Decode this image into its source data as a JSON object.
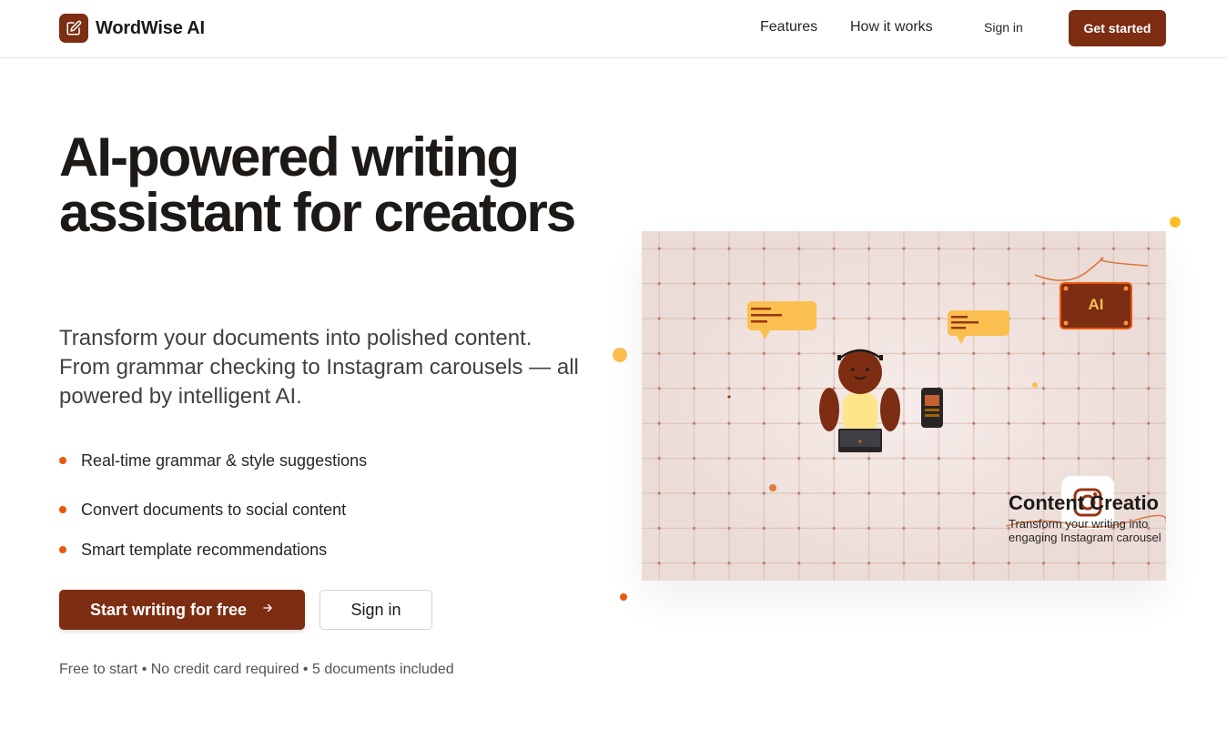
{
  "header": {
    "brand": "WordWise AI",
    "nav": {
      "features": "Features",
      "how_it_works": "How it works"
    },
    "sign_in": "Sign in",
    "get_started": "Get started"
  },
  "hero": {
    "title": "AI-powered writing assistant for creators",
    "subtitle": "Transform your documents into polished content. From grammar checking to Instagram carousels — all powered by intelligent AI.",
    "features": [
      "Real-time grammar & style suggestions",
      "Convert documents to social content",
      "Smart template recommendations"
    ],
    "cta_primary": "Start writing for free",
    "cta_primary_icon": "arrow-right-icon",
    "cta_secondary": "Sign in",
    "fine_print": "Free to start • No credit card required • 5 documents included"
  },
  "illustration": {
    "ai_badge": "AI",
    "card_title": "Content Creatio",
    "card_desc": "Transform your writing into engaging Instagram carousel"
  },
  "colors": {
    "brand": "#7c2d12",
    "accent_orange": "#ea580c",
    "bubble_yellow": "#fbbf4f",
    "illustration_bg": "#f0e5e2"
  }
}
